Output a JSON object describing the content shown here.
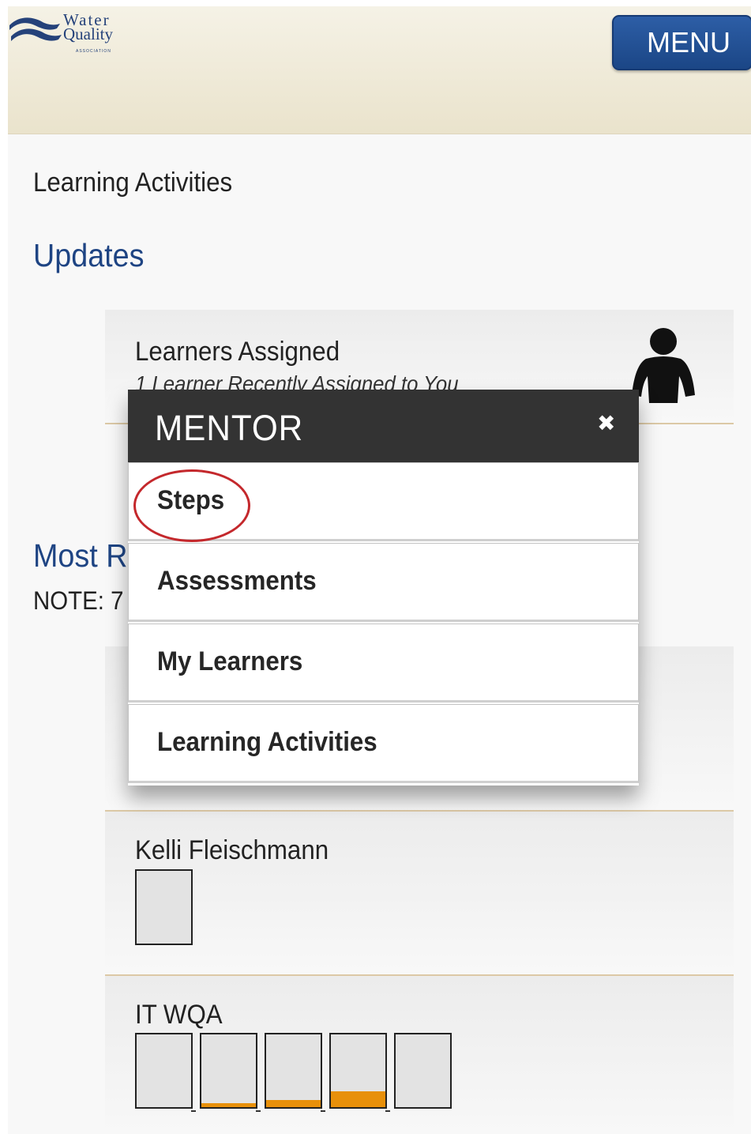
{
  "header": {
    "logo": {
      "line1": "Water",
      "line2": "Quality",
      "line3": "ASSOCIATION"
    },
    "menu_label": "MENU",
    "brand_color": "#1e4483"
  },
  "page_title": "Learning Activities",
  "updates": {
    "heading": "Updates",
    "learners_card": {
      "title": "Learners Assigned",
      "subtitle": "1 Learner Recently Assigned to You"
    }
  },
  "most_recent": {
    "heading": "Most Re",
    "note": "NOTE: 7"
  },
  "learners": [
    {
      "name": "Kelli Fleischmann",
      "steps": [
        0
      ]
    },
    {
      "name": "IT WQA",
      "steps": [
        0,
        0.05,
        0.1,
        0.22,
        0
      ]
    }
  ],
  "modal": {
    "title": "MENTOR",
    "close_icon": "close-icon",
    "items": [
      {
        "label": "Steps",
        "highlighted": true
      },
      {
        "label": "Assessments"
      },
      {
        "label": "My Learners"
      },
      {
        "label": "Learning Activities"
      }
    ],
    "highlight_color": "#c4282c",
    "progress_color": "#e8900a"
  }
}
